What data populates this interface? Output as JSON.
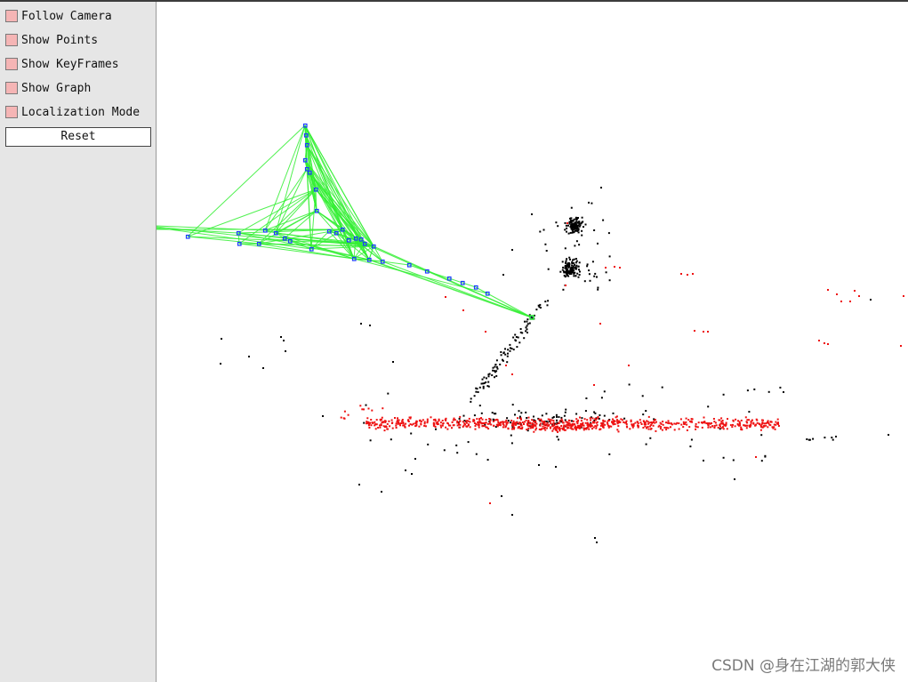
{
  "panel": {
    "options": [
      {
        "id": "follow-camera",
        "label": "Follow Camera"
      },
      {
        "id": "show-points",
        "label": "Show Points"
      },
      {
        "id": "show-keyframes",
        "label": "Show KeyFrames"
      },
      {
        "id": "show-graph",
        "label": "Show Graph"
      },
      {
        "id": "localization-mode",
        "label": "Localization Mode"
      }
    ],
    "reset_label": "Reset"
  },
  "colors": {
    "panel_bg": "#e6e6e6",
    "checkbox_fill": "#f5b5b5",
    "graph_edge": "#33ee33",
    "keyframe": "#1a3cff",
    "map_point": "#000000",
    "local_map_point": "#ee1111"
  },
  "watermark": "CSDN @身在江湖的郭大侠"
}
